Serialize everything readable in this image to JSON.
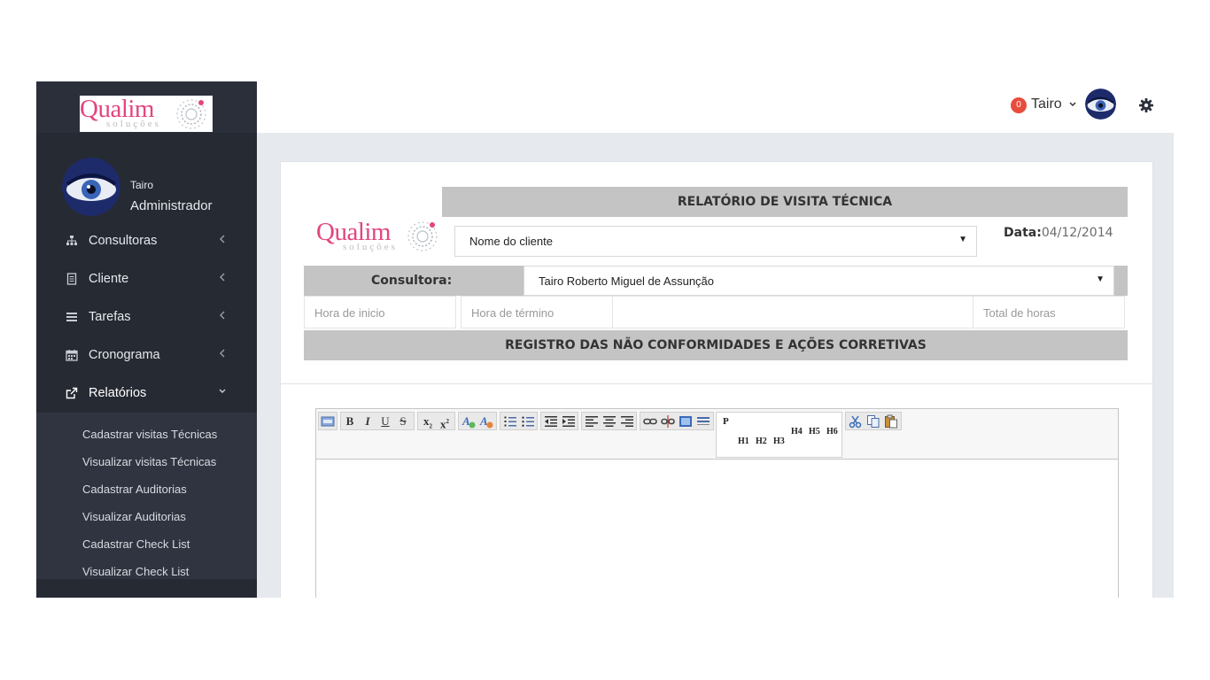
{
  "brand": {
    "name": "Qualim",
    "tagline": "soluções"
  },
  "sidebar": {
    "profile": {
      "name": "Tairo",
      "role": "Administrador"
    },
    "menu": [
      {
        "label": "Consultoras",
        "icon": "sitemap-icon"
      },
      {
        "label": "Cliente",
        "icon": "file-icon"
      },
      {
        "label": "Tarefas",
        "icon": "list-icon"
      },
      {
        "label": "Cronograma",
        "icon": "calendar-icon"
      },
      {
        "label": "Relatórios",
        "icon": "external-link-icon",
        "active": true
      }
    ],
    "submenu": [
      "Cadastrar visitas Técnicas",
      "Visualizar visitas Técnicas",
      "Cadastrar Auditorias",
      "Visualizar Auditorias",
      "Cadastrar Check List",
      "Visualizar Check List"
    ]
  },
  "topbar": {
    "notification_count": "0",
    "user_name": "Tairo"
  },
  "form": {
    "title": "RELATÓRIO DE VISITA TÉCNICA",
    "client_select": "Nome do cliente",
    "date_label": "Data:",
    "date_value": "04/12/2014",
    "consultora_label": "Consultora:",
    "consultora_select": "Tairo Roberto Miguel de Assunção",
    "fields": {
      "start_placeholder": "Hora de inicio",
      "end_placeholder": "Hora de término",
      "total_placeholder": "Total de horas"
    },
    "section_title": "REGISTRO DAS NÃO CONFORMIDADES E AÇÕES CORRETIVAS"
  },
  "editor": {
    "toolbar": {
      "bold": "B",
      "italic": "I",
      "underline": "U",
      "strike": "S",
      "subscript": "x",
      "superscript": "x",
      "paragraph": "P",
      "headings": [
        "H1",
        "H2",
        "H3",
        "H4",
        "H5",
        "H6"
      ]
    }
  },
  "colors": {
    "accent_pink": "#e2457f",
    "sidebar_bg": "#262a33",
    "badge_red": "#e74c3c",
    "bar_gray": "#c4c4c4"
  }
}
